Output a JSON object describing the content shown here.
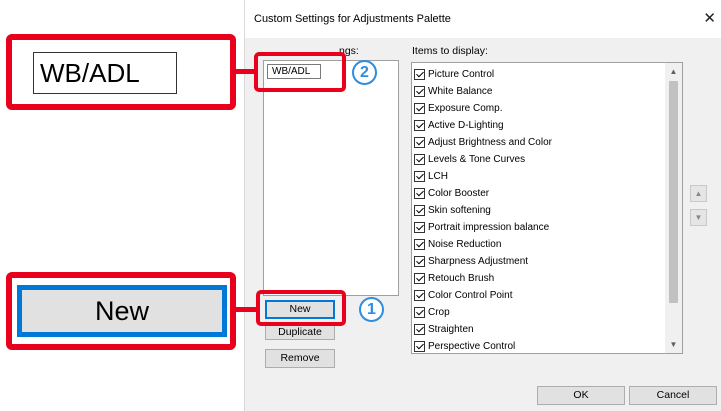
{
  "dialog": {
    "title": "Custom Settings for Adjustments Palette",
    "close_icon": "close-icon",
    "custom_settings_label": "ngs:",
    "items_label": "Items to display:",
    "new_setting_name": "WB/ADL",
    "buttons": {
      "new": "New",
      "duplicate": "Duplicate",
      "remove": "Remove",
      "ok": "OK",
      "cancel": "Cancel"
    },
    "items": [
      "Picture Control",
      "White Balance",
      "Exposure Comp.",
      "Active D-Lighting",
      "Adjust Brightness and Color",
      "Levels & Tone Curves",
      "LCH",
      "Color Booster",
      "Skin softening",
      "Portrait impression balance",
      "Noise Reduction",
      "Sharpness Adjustment",
      "Retouch Brush",
      "Color Control Point",
      "Crop",
      "Straighten",
      "Perspective Control"
    ],
    "move_up_icon": "arrow-up-icon",
    "move_down_icon": "arrow-down-icon"
  },
  "callouts": {
    "zoom_name": "WB/ADL",
    "zoom_new": "New",
    "step1": "1",
    "step2": "2",
    "highlight_color": "#e8001c",
    "badge_color": "#2e8de0"
  }
}
